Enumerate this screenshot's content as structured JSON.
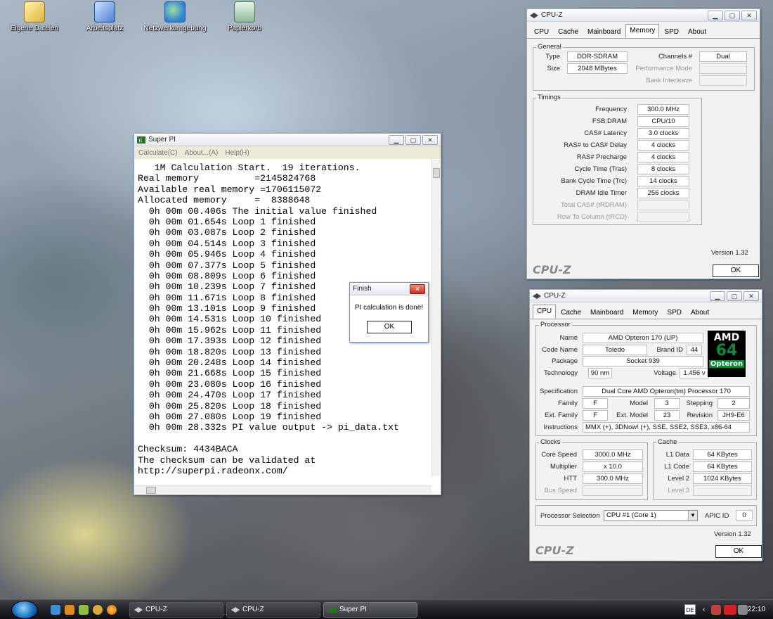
{
  "desktop": {
    "icons": [
      {
        "label": "Eigene Dateien"
      },
      {
        "label": "Arbeitsplatz"
      },
      {
        "label": "Netzwerkumgebung"
      },
      {
        "label": "Papierkorb"
      }
    ]
  },
  "superpi": {
    "title": "Super PI",
    "menu": [
      "Calculate(C)",
      "About...(A)",
      "Help(H)"
    ],
    "lines": [
      "   1M Calculation Start.  19 iterations.",
      "Real memory          =2145824768",
      "Available real memory =1706115072",
      "Allocated memory     =  8388648",
      "  0h 00m 00.406s The initial value finished",
      "  0h 00m 01.654s Loop 1 finished",
      "  0h 00m 03.087s Loop 2 finished",
      "  0h 00m 04.514s Loop 3 finished",
      "  0h 00m 05.946s Loop 4 finished",
      "  0h 00m 07.377s Loop 5 finished",
      "  0h 00m 08.809s Loop 6 finished",
      "  0h 00m 10.239s Loop 7 finished",
      "  0h 00m 11.671s Loop 8 finished",
      "  0h 00m 13.101s Loop 9 finished",
      "  0h 00m 14.531s Loop 10 finished",
      "  0h 00m 15.962s Loop 11 finished",
      "  0h 00m 17.393s Loop 12 finished",
      "  0h 00m 18.820s Loop 13 finished",
      "  0h 00m 20.248s Loop 14 finished",
      "  0h 00m 21.668s Loop 15 finished",
      "  0h 00m 23.080s Loop 16 finished",
      "  0h 00m 24.470s Loop 17 finished",
      "  0h 00m 25.820s Loop 18 finished",
      "  0h 00m 27.080s Loop 19 finished",
      "  0h 00m 28.332s PI value output -> pi_data.txt",
      "",
      "Checksum: 4434BACA",
      "The checksum can be validated at",
      "http://superpi.radeonx.com/"
    ]
  },
  "finish_dialog": {
    "title": "Finish",
    "message": "PI calculation is done!",
    "ok_label": "OK"
  },
  "cpuz_memory": {
    "title": "CPU-Z",
    "tabs": [
      "CPU",
      "Cache",
      "Mainboard",
      "Memory",
      "SPD",
      "About"
    ],
    "active_tab": "Memory",
    "general": {
      "title": "General",
      "type_label": "Type",
      "type_value": "DDR-SDRAM",
      "size_label": "Size",
      "size_value": "2048 MBytes",
      "channels_label": "Channels #",
      "channels_value": "Dual",
      "perf_mode_label": "Performance Mode",
      "bank_interleave_label": "Bank Interleave"
    },
    "timings": {
      "title": "Timings",
      "rows": [
        {
          "label": "Frequency",
          "value": "300.0 MHz"
        },
        {
          "label": "FSB:DRAM",
          "value": "CPU/10"
        },
        {
          "label": "CAS# Latency",
          "value": "3.0 clocks"
        },
        {
          "label": "RAS# to CAS# Delay",
          "value": "4 clocks"
        },
        {
          "label": "RAS# Precharge",
          "value": "4 clocks"
        },
        {
          "label": "Cycle Time (Tras)",
          "value": "8 clocks"
        },
        {
          "label": "Bank Cycle Time (Trc)",
          "value": "14 clocks"
        },
        {
          "label": "DRAM Idle Timer",
          "value": "256 clocks"
        },
        {
          "label": "Total CAS# (tRDRAM)",
          "value": ""
        },
        {
          "label": "Row To Column (tRCD)",
          "value": ""
        }
      ]
    },
    "version": "Version 1.32",
    "logo": "CPU-Z",
    "ok_label": "OK"
  },
  "cpuz_cpu": {
    "title": "CPU-Z",
    "tabs": [
      "CPU",
      "Cache",
      "Mainboard",
      "Memory",
      "SPD",
      "About"
    ],
    "active_tab": "CPU",
    "processor": {
      "title": "Processor",
      "name_label": "Name",
      "name_value": "AMD Opteron 170 (UP)",
      "codename_label": "Code Name",
      "codename_value": "Toledo",
      "brandid_label": "Brand ID",
      "brandid_value": "44",
      "package_label": "Package",
      "package_value": "Socket 939",
      "technology_label": "Technology",
      "technology_value": "90 nm",
      "voltage_label": "Voltage",
      "voltage_value": "1.456 v",
      "spec_label": "Specification",
      "spec_value": "Dual Core AMD Opteron(tm) Processor 170",
      "family_label": "Family",
      "family_value": "F",
      "model_label": "Model",
      "model_value": "3",
      "stepping_label": "Stepping",
      "stepping_value": "2",
      "extfamily_label": "Ext. Family",
      "extfamily_value": "F",
      "extmodel_label": "Ext. Model",
      "extmodel_value": "23",
      "revision_label": "Revision",
      "revision_value": "JH9-E6",
      "instructions_label": "Instructions",
      "instructions_value": "MMX (+), 3DNow! (+), SSE, SSE2, SSE3, x86-64"
    },
    "amd_logo": {
      "line1": "AMD",
      "line2": "64",
      "line3": "Opteron"
    },
    "clocks": {
      "title": "Clocks",
      "core_speed_label": "Core Speed",
      "core_speed_value": "3000.0 MHz",
      "multiplier_label": "Multiplier",
      "multiplier_value": "x 10.0",
      "htt_label": "HTT",
      "htt_value": "300.0 MHz",
      "bus_speed_label": "Bus Speed"
    },
    "cache": {
      "title": "Cache",
      "l1data_label": "L1 Data",
      "l1data_value": "64 KBytes",
      "l1code_label": "L1 Code",
      "l1code_value": "64 KBytes",
      "level2_label": "Level 2",
      "level2_value": "1024 KBytes",
      "level3_label": "Level 3"
    },
    "selection": {
      "label": "Processor Selection",
      "value": "CPU #1 (Core 1)",
      "apic_label": "APIC ID",
      "apic_value": "0"
    },
    "version": "Version 1.32",
    "logo": "CPU-Z",
    "ok_label": "OK"
  },
  "taskbar": {
    "tasks": [
      {
        "label": "CPU-Z"
      },
      {
        "label": "CPU-Z"
      },
      {
        "label": "Super PI"
      }
    ],
    "lang": "DE",
    "clock": "22:10"
  },
  "colors": {
    "titlebar_close": "#c9311c",
    "amd_green": "#0a8a3a"
  }
}
